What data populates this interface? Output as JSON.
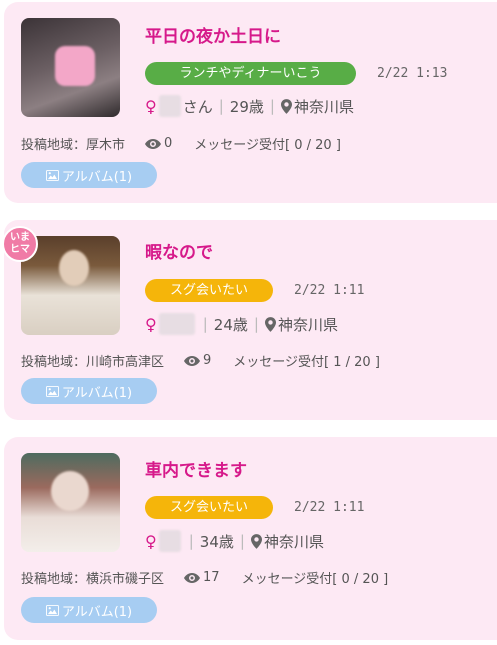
{
  "posts": [
    {
      "title": "平日の夜か土日に",
      "tag": "ランチやディナーいこう",
      "tag_color": "#58ad46",
      "time": "2/22 1:13",
      "gender_icon": "venus-icon",
      "name_suffix": "さん",
      "age": "29歳",
      "location": "神奈川県",
      "area_label": "投稿地域：厚木市",
      "views": "0",
      "message_status": "メッセージ受付[ 0 / 20 ]",
      "album_label": "アルバム(1)"
    },
    {
      "badge": "いま\nヒマ",
      "title": "暇なので",
      "tag": "スグ会いたい",
      "tag_color": "#f5b50a",
      "time": "2/22 1:11",
      "gender_icon": "venus-icon",
      "age": "24歳",
      "location": "神奈川県",
      "area_label": "投稿地域：川崎市高津区",
      "views": "9",
      "message_status": "メッセージ受付[ 1 / 20 ]",
      "album_label": "アルバム(1)"
    },
    {
      "title": "車内できます",
      "tag": "スグ会いたい",
      "tag_color": "#f5b50a",
      "time": "2/22 1:11",
      "gender_icon": "venus-icon",
      "age": "34歳",
      "location": "神奈川県",
      "area_label": "投稿地域：横浜市磯子区",
      "views": "17",
      "message_status": "メッセージ受付[ 0 / 20 ]",
      "album_label": "アルバム(1)"
    }
  ],
  "colors": {
    "card_bg": "#fde9f4",
    "title": "#d6198a",
    "album_button": "#a7cdf2"
  }
}
